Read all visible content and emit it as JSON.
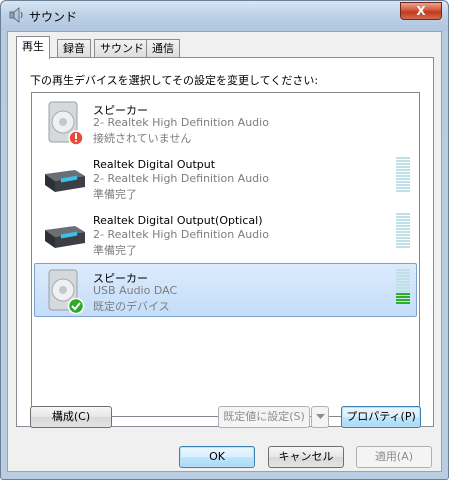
{
  "window": {
    "title": "サウンド",
    "close_label": "X"
  },
  "tabs": [
    {
      "label": "再生",
      "active": true
    },
    {
      "label": "録音",
      "active": false
    },
    {
      "label": "サウンド",
      "active": false
    },
    {
      "label": "通信",
      "active": false
    }
  ],
  "instruction": "下の再生デバイスを選択してその設定を変更してください:",
  "devices": [
    {
      "name": "スピーカー",
      "driver": "2- Realtek High Definition Audio",
      "status": "接続されていません",
      "icon": "speaker-disconnected-icon",
      "selected": false
    },
    {
      "name": "Realtek Digital Output",
      "driver": "2- Realtek High Definition Audio",
      "status": "準備完了",
      "icon": "digital-output-device-icon",
      "selected": false
    },
    {
      "name": "Realtek Digital Output(Optical)",
      "driver": "2- Realtek High Definition Audio",
      "status": "準備完了",
      "icon": "digital-output-device-icon",
      "selected": false
    },
    {
      "name": "スピーカー",
      "driver": "USB Audio DAC",
      "status": "既定のデバイス",
      "icon": "speaker-default-icon",
      "selected": true
    }
  ],
  "buttons": {
    "configure": "構成(C)",
    "set_default": "既定値に設定(S)",
    "properties": "プロパティ(P)",
    "ok": "OK",
    "cancel": "キャンセル",
    "apply": "適用(A)"
  },
  "colors": {
    "selection": "#c4ddfa",
    "meter_active": "#2eae27",
    "meter_idle": "#bfe0e6"
  }
}
